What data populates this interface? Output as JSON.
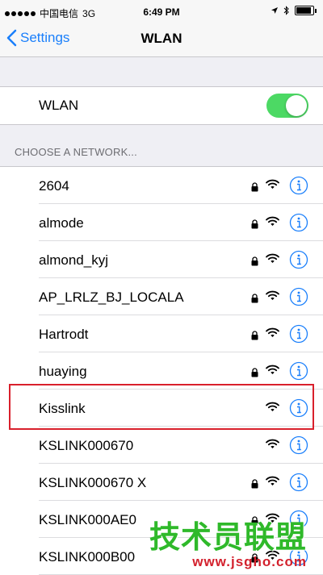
{
  "status_bar": {
    "carrier": "中国电信",
    "network": "3G",
    "time": "6:49 PM"
  },
  "nav": {
    "back_label": "Settings",
    "title": "WLAN"
  },
  "wlan": {
    "label": "WLAN",
    "enabled": true
  },
  "section_header": "CHOOSE A NETWORK...",
  "networks": [
    {
      "name": "2604",
      "secured": true
    },
    {
      "name": "almode",
      "secured": true
    },
    {
      "name": "almond_kyj",
      "secured": true
    },
    {
      "name": "AP_LRLZ_BJ_LOCALA",
      "secured": true
    },
    {
      "name": "Hartrodt",
      "secured": true
    },
    {
      "name": "huaying",
      "secured": true
    },
    {
      "name": "Kisslink",
      "secured": false
    },
    {
      "name": "KSLINK000670",
      "secured": false
    },
    {
      "name": "KSLINK000670 X",
      "secured": true
    },
    {
      "name": "KSLINK000AE0",
      "secured": true
    },
    {
      "name": "KSLINK000B00",
      "secured": true
    }
  ],
  "watermark": {
    "title": "技术员联盟",
    "url": "www.jsgho.com"
  },
  "colors": {
    "accent": "#1a7ffb",
    "toggle_on": "#4cd964",
    "highlight": "#d9202c"
  }
}
